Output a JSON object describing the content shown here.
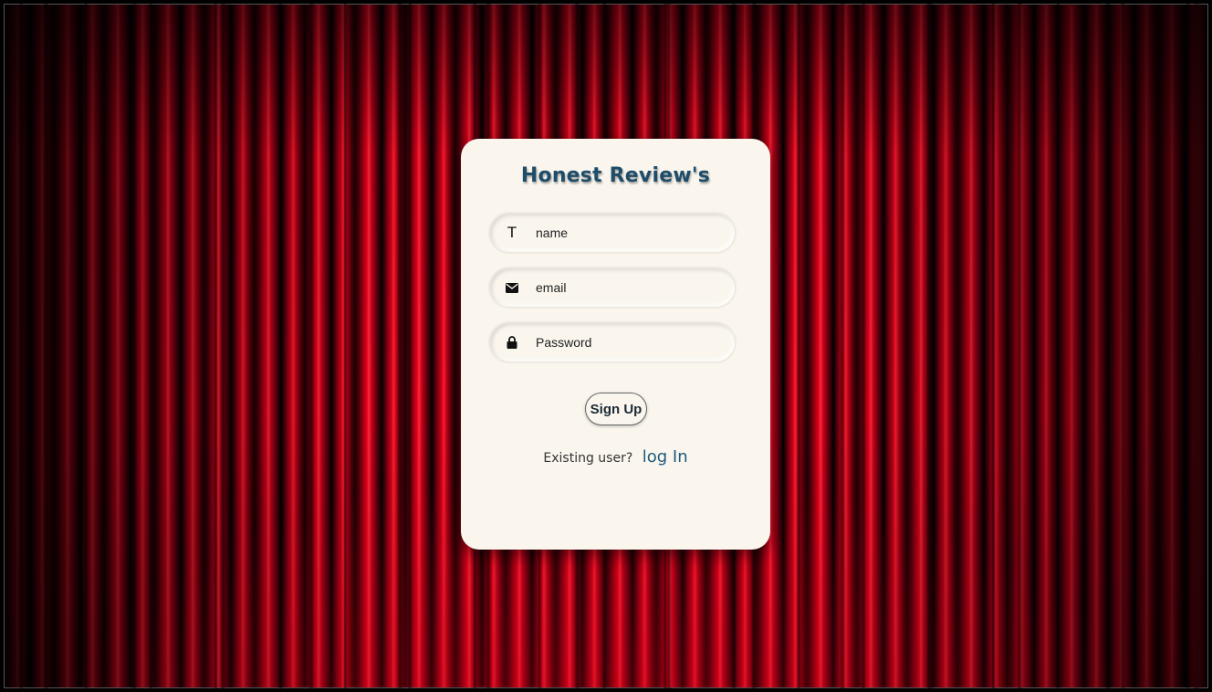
{
  "app": {
    "title": "Honest Review's"
  },
  "form": {
    "name": {
      "placeholder": "name",
      "value": "",
      "icon": "text-icon"
    },
    "email": {
      "placeholder": "email",
      "value": "",
      "icon": "envelope-icon"
    },
    "password": {
      "placeholder": "Password",
      "value": "",
      "icon": "lock-icon"
    },
    "submit_label": "Sign Up"
  },
  "footer": {
    "question": "Existing user?",
    "link_label": "log In"
  },
  "colors": {
    "title": "#1e4d6a",
    "card_background": "#faf6ee",
    "link": "#1e5a7a",
    "curtain": "#d2001a"
  }
}
